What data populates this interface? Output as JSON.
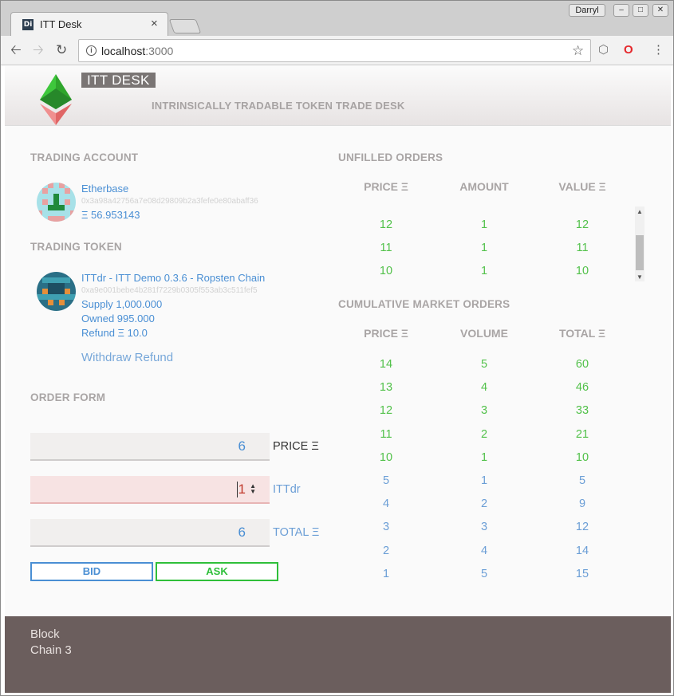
{
  "browser": {
    "tab_title": "ITT Desk",
    "tab_favicon": "Di",
    "close_glyph": "×",
    "user": "Darryl",
    "url_host": "localhost",
    "url_port": ":3000"
  },
  "header": {
    "brand": "ITT DESK",
    "subtitle": "INTRINSICALLY TRADABLE TOKEN TRADE DESK"
  },
  "trading_account": {
    "title": "TRADING ACCOUNT",
    "name": "Etherbase",
    "address": "0x3a98a42756a7e08d29809b2a3fefe0e80abaff36",
    "balance": "Ξ 56.953143"
  },
  "trading_token": {
    "title": "TRADING TOKEN",
    "name": "ITTdr - ITT Demo 0.3.6 - Ropsten Chain",
    "address": "0xa9e001bebe4b281f7229b0305f553ab3c511fef5",
    "supply": "Supply 1,000.000",
    "owned": "Owned 995.000",
    "refund": "Refund Ξ 10.0",
    "withdraw": "Withdraw Refund"
  },
  "order_form": {
    "title": "ORDER FORM",
    "price_value": "6",
    "price_label": "PRICE Ξ",
    "amount_value": "1",
    "amount_label": "ITTdr",
    "total_value": "6",
    "total_label": "TOTAL Ξ",
    "bid": "BID",
    "ask": "ASK"
  },
  "unfilled_orders": {
    "title": "UNFILLED ORDERS",
    "headers": [
      "PRICE Ξ",
      "AMOUNT",
      "VALUE Ξ"
    ],
    "rows": [
      [
        "12",
        "1",
        "12"
      ],
      [
        "11",
        "1",
        "11"
      ],
      [
        "10",
        "1",
        "10"
      ]
    ]
  },
  "cumulative_orders": {
    "title": "CUMULATIVE MARKET ORDERS",
    "headers": [
      "PRICE Ξ",
      "VOLUME",
      "TOTAL Ξ"
    ],
    "rows": [
      [
        "14",
        "5",
        "60"
      ],
      [
        "13",
        "4",
        "46"
      ],
      [
        "12",
        "3",
        "33"
      ],
      [
        "11",
        "2",
        "21"
      ],
      [
        "10",
        "1",
        "10"
      ],
      [
        "5",
        "1",
        "5"
      ],
      [
        "4",
        "2",
        "9"
      ],
      [
        "3",
        "3",
        "12"
      ],
      [
        "2",
        "4",
        "14"
      ],
      [
        "1",
        "5",
        "15"
      ]
    ],
    "row_colors": [
      "green",
      "green",
      "green",
      "green",
      "green",
      "blue",
      "blue",
      "blue",
      "blue",
      "blue"
    ]
  },
  "footer": {
    "line1": "Block",
    "line2": "Chain 3"
  }
}
